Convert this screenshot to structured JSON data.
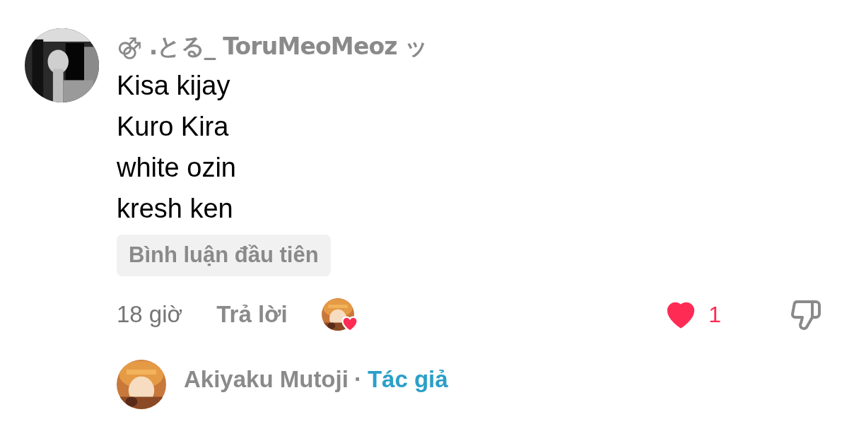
{
  "comment": {
    "author": "⚣ .とる_ ToruMeoMeoz ッ",
    "lines": [
      "Kisa kijay",
      "Kuro Kira",
      "white ozin",
      "kresh ken"
    ],
    "badge": "Bình luận đầu tiên",
    "time": "18 giờ",
    "reply_label": "Trả lời",
    "creator_liked": true,
    "liked": true,
    "like_count": "1",
    "reply": {
      "author": "Akiyaku Mutoji",
      "separator": "·",
      "tag": "Tác giả"
    }
  }
}
